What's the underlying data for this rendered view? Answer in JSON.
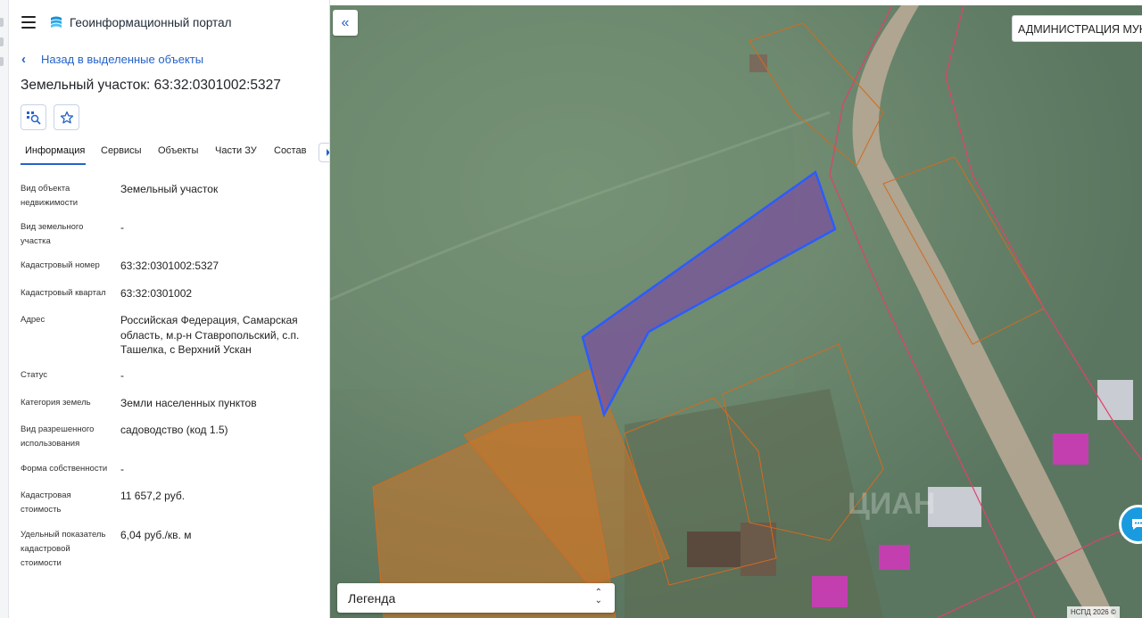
{
  "app": {
    "title": "Геоинформационный портал",
    "menu_icon": "hamburger-icon",
    "logo_icon": "portal-logo-icon"
  },
  "nav": {
    "back_label": "Назад в выделенные объекты"
  },
  "object": {
    "title": "Земельный участок: 63:32:0301002:5327"
  },
  "toolbar": {
    "zoom_icon": "zoom-to-object-icon",
    "favorite_icon": "star-icon"
  },
  "tabs": [
    {
      "label": "Информация",
      "active": true
    },
    {
      "label": "Сервисы",
      "active": false
    },
    {
      "label": "Объекты",
      "active": false
    },
    {
      "label": "Части ЗУ",
      "active": false
    },
    {
      "label": "Состав",
      "active": false
    }
  ],
  "info": [
    {
      "label": "Вид объекта недвижимости",
      "value": "Земельный участок"
    },
    {
      "label": "Вид земельного участка",
      "value": "-"
    },
    {
      "label": "Кадастровый номер",
      "value": "63:32:0301002:5327"
    },
    {
      "label": "Кадастровый квартал",
      "value": "63:32:0301002"
    },
    {
      "label": "Адрес",
      "value": "Российская Федерация, Самарская область, м.р-н Ставропольский, с.п. Ташелка, с Верхний Ускан"
    },
    {
      "label": "Статус",
      "value": "-"
    },
    {
      "label": "Категория земель",
      "value": "Земли населенных пунктов"
    },
    {
      "label": "Вид разрешенного использования",
      "value": "садоводство (код 1.5)"
    },
    {
      "label": "Форма собственности",
      "value": "-"
    },
    {
      "label": "Кадастровая стоимость",
      "value": "11 657,2 руб."
    },
    {
      "label": "Удельный показатель кадастровой стоимости",
      "value": "6,04 руб./кв. м"
    }
  ],
  "map": {
    "admin_layer_label": "АДМИНИСТРАЦИЯ МУНИ",
    "legend_label": "Легенда",
    "attribution": "НСПД 2026 ©",
    "watermark": "ЦИАН",
    "colors": {
      "selected_fill": "#7a4fa0",
      "selected_stroke": "#2b5cff",
      "neighbor_fill": "#c8762a",
      "boundary": "#e0426a",
      "accent": "#2563c9"
    }
  }
}
